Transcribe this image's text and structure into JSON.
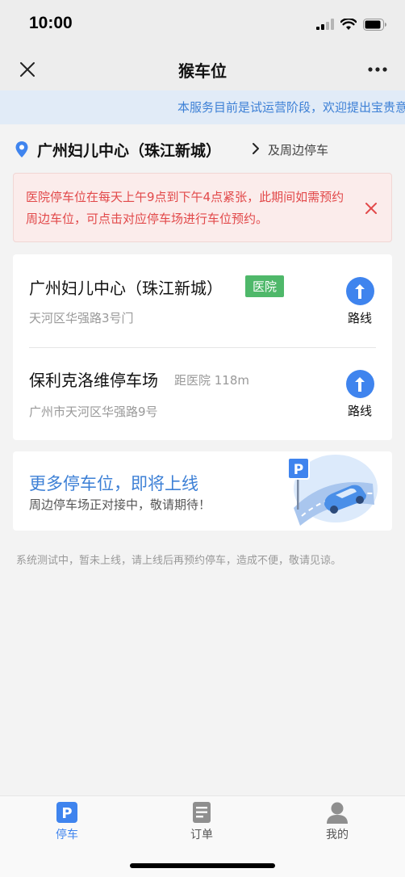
{
  "status_bar": {
    "time": "10:00"
  },
  "nav": {
    "title": "猴车位",
    "close_icon": "close-icon",
    "more_icon": "more-icon"
  },
  "notice": {
    "text": "本服务目前是试运营阶段，欢迎提出宝贵意见"
  },
  "location": {
    "name": "广州妇儿中心（珠江新城）",
    "nearby_label": "及周边停车"
  },
  "alert": {
    "text": "医院停车位在每天上午9点到下午4点紧张，此期间如需预约周边车位，可点击对应停车场进行车位预约。"
  },
  "lots": [
    {
      "name": "广州妇儿中心（珠江新城）",
      "tag": "医院",
      "distance": "",
      "address": "天河区华强路3号门",
      "route_label": "路线"
    },
    {
      "name": "保利克洛维停车场",
      "tag": "",
      "distance": "距医院 118m",
      "address": "广州市天河区华强路9号",
      "route_label": "路线"
    }
  ],
  "promo": {
    "title": "更多停车位，即将上线",
    "subtitle": "周边停车场正对接中，敬请期待！"
  },
  "footnote": "系统测试中，暂未上线，请上线后再预约停车，造成不便，敬请见谅。",
  "tabs": [
    {
      "label": "停车",
      "icon": "parking-icon",
      "active": true
    },
    {
      "label": "订单",
      "icon": "order-icon",
      "active": false
    },
    {
      "label": "我的",
      "icon": "user-icon",
      "active": false
    }
  ],
  "colors": {
    "accent": "#3f84ee",
    "hospital_tag": "#4fb86a",
    "alert_text": "#e2494a",
    "notice_text": "#3d80d6"
  }
}
